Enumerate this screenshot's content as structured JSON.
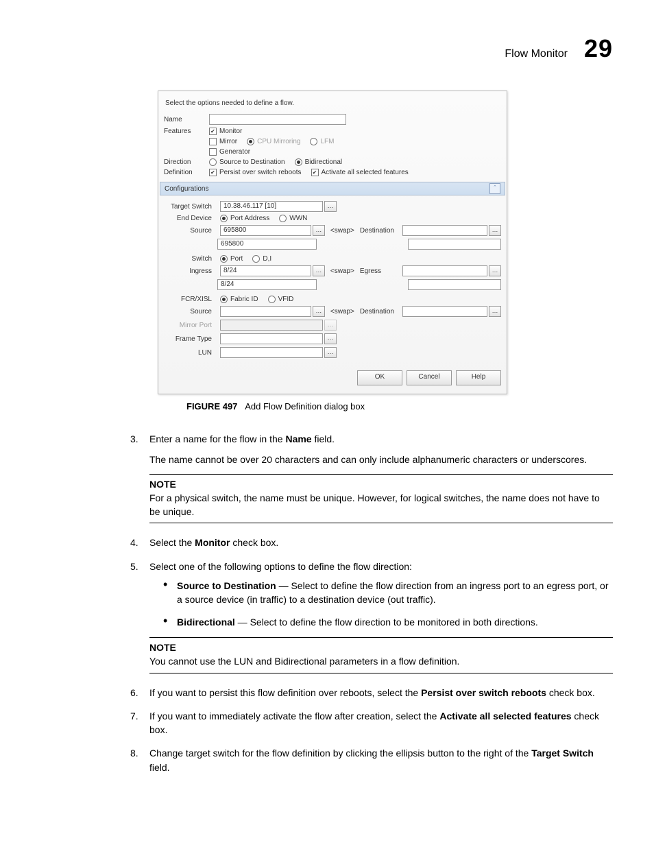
{
  "header": {
    "title": "Flow Monitor",
    "chapter": "29"
  },
  "dialog": {
    "intro": "Select the options needed to define a flow.",
    "name_label": "Name",
    "features_label": "Features",
    "monitor_label": "Monitor",
    "mirror_label": "Mirror",
    "cpu_mirroring_label": "CPU Mirroring",
    "lfm_label": "LFM",
    "generator_label": "Generator",
    "direction_label": "Direction",
    "src_to_dest_label": "Source to Destination",
    "bidirectional_label": "Bidirectional",
    "definition_label": "Definition",
    "persist_label": "Persist over switch reboots",
    "activate_label": "Activate all selected features",
    "config_title": "Configurations",
    "target_switch_label": "Target Switch",
    "target_switch_value": "10.38.46.117 [10]",
    "end_device_label": "End Device",
    "port_address_label": "Port Address",
    "wwn_label": "WWN",
    "source_label": "Source",
    "source_value": "695800",
    "source_below": "695800",
    "swap_label": "<swap>",
    "destination_label": "Destination",
    "switch_label": "Switch",
    "port_label": "Port",
    "di_label": "D,I",
    "ingress_label": "Ingress",
    "ingress_value": "8/24",
    "ingress_below": "8/24",
    "egress_label": "Egress",
    "fcr_label": "FCR/XISL",
    "fabric_id_label": "Fabric ID",
    "vfid_label": "VFID",
    "fcr_source_label": "Source",
    "fcr_dest_label": "Destination",
    "mirror_port_label": "Mirror Port",
    "frame_type_label": "Frame Type",
    "lun_label": "LUN",
    "ellipsis": "…",
    "ok": "OK",
    "cancel": "Cancel",
    "help": "Help"
  },
  "caption": {
    "fignum": "FIGURE 497",
    "text": "Add Flow Definition dialog box"
  },
  "body": {
    "s3_num": "3.",
    "s3a": "Enter a name for the flow in the ",
    "s3b": "Name",
    "s3c": " field.",
    "s3_p2": "The name cannot be over 20 characters and can only include alphanumeric characters or underscores.",
    "note1_head": "NOTE",
    "note1_body": "For a physical switch, the name must be unique. However, for logical switches, the name does not have to be unique.",
    "s4_num": "4.",
    "s4a": "Select the ",
    "s4b": "Monitor",
    "s4c": " check box.",
    "s5_num": "5.",
    "s5": "Select one of the following options to define the flow direction:",
    "b1a": "Source to Destination",
    "b1b": " — Select to define the flow direction from an ingress port to an egress port, or a source device (in traffic) to a destination device (out traffic).",
    "b2a": "Bidirectional",
    "b2b": " — Select to define the flow direction to be monitored in both directions.",
    "note2_head": "NOTE",
    "note2_body": "You cannot use the LUN and Bidirectional parameters in a flow definition.",
    "s6_num": "6.",
    "s6a": "If you want to persist this flow definition over reboots, select the ",
    "s6b": "Persist over switch reboots",
    "s6c": " check box.",
    "s7_num": "7.",
    "s7a": "If you want to immediately activate the flow after creation, select the ",
    "s7b": "Activate all selected features",
    "s7c": " check box.",
    "s8_num": "8.",
    "s8a": "Change target switch for the flow definition by clicking the ellipsis button to the right of the ",
    "s8b": "Target Switch",
    "s8c": " field."
  }
}
